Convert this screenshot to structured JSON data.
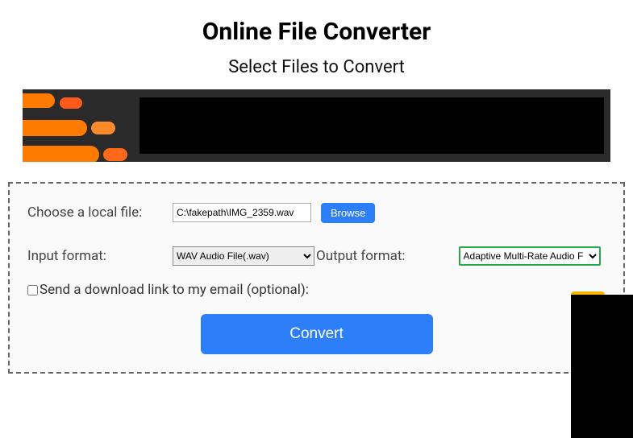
{
  "header": {
    "title": "Online File Converter",
    "subtitle": "Select Files to Convert"
  },
  "form": {
    "chooseFileLabel": "Choose a local file:",
    "filePath": "C:\\fakepath\\IMG_2359.wav",
    "browseLabel": "Browse",
    "inputFormatLabel": "Input format:",
    "inputFormatValue": "WAV Audio File(.wav)",
    "outputFormatLabel": "Output format:",
    "outputFormatValue": "Adaptive Multi-Rate Audio F",
    "emailCheckboxLabel": "Send a download link to my email (optional):",
    "convertLabel": "Convert"
  }
}
